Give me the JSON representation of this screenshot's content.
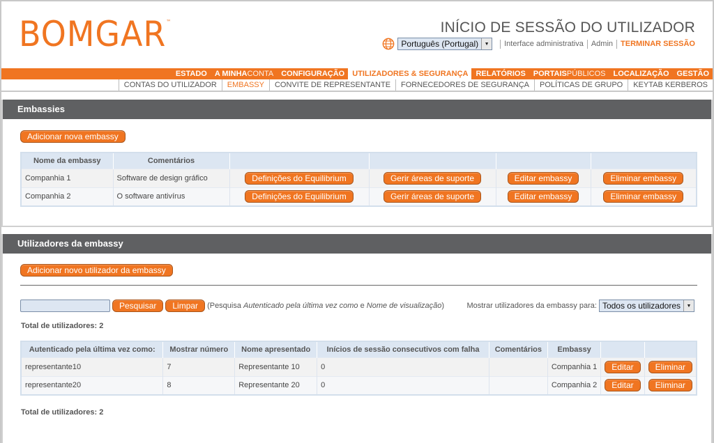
{
  "header": {
    "logo": "BOMGAR",
    "logo_tm": "™",
    "title": "INÍCIO DE SESSÃO DO UTILIZADOR",
    "language": "Português (Portugal)",
    "links": [
      "Interface administrativa",
      "Admin"
    ],
    "logout": "TERMINAR SESSÃO"
  },
  "nav": {
    "items": [
      {
        "bold": "ESTADO",
        "light": ""
      },
      {
        "bold": "A MINHA",
        "light": "CONTA"
      },
      {
        "bold": "CONFIGURAÇÃO",
        "light": ""
      },
      {
        "bold": "UTILIZADORES & SEGURANÇA",
        "light": ""
      },
      {
        "bold": "RELATÓRIOS",
        "light": ""
      },
      {
        "bold": "PORTAIS",
        "light": "PÚBLICOS"
      },
      {
        "bold": "LOCALIZAÇÃO",
        "light": ""
      },
      {
        "bold": "GESTÃO",
        "light": ""
      }
    ],
    "active_index": 3,
    "subitems": [
      "CONTAS DO UTILIZADOR",
      "EMBASSY",
      "CONVITE DE REPRESENTANTE",
      "FORNECEDORES DE SEGURANÇA",
      "POLÍTICAS DE GRUPO",
      "KEYTAB KERBEROS"
    ],
    "sub_active_index": 1
  },
  "embassies": {
    "title": "Embassies",
    "add_button": "Adicionar nova embassy",
    "columns": [
      "Nome da embassy",
      "Comentários"
    ],
    "rows": [
      {
        "name": "Companhia 1",
        "comment": "Software de design gráfico"
      },
      {
        "name": "Companhia 2",
        "comment": "O software antivírus"
      }
    ],
    "row_actions": [
      "Definições do Equilibrium",
      "Gerir áreas de suporte",
      "Editar embassy",
      "Eliminar embassy"
    ]
  },
  "users": {
    "title": "Utilizadores da embassy",
    "add_button": "Adicionar novo utilizador da embassy",
    "search_value": "",
    "search_button": "Pesquisar",
    "clear_button": "Limpar",
    "hint_prefix": "(Pesquisa ",
    "hint_field1": "Autenticado pela última vez como",
    "hint_mid": " e ",
    "hint_field2": "Nome de visualização",
    "hint_suffix": ")",
    "filter_label": "Mostrar utilizadores da embassy para:",
    "filter_value": "Todos os utilizadores",
    "total_label": "Total de utilizadores: 2",
    "columns": [
      "Autenticado pela última vez como:",
      "Mostrar número",
      "Nome apresentado",
      "Inícios de sessão consecutivos com falha",
      "Comentários",
      "Embassy"
    ],
    "rows": [
      {
        "login": "representante10",
        "number": "7",
        "display": "Representante 10",
        "failed": "0",
        "comment": "",
        "embassy": "Companhia 1"
      },
      {
        "login": "representante20",
        "number": "8",
        "display": "Representante 20",
        "failed": "0",
        "comment": "",
        "embassy": "Companhia 2"
      }
    ],
    "edit_button": "Editar",
    "delete_button": "Eliminar"
  },
  "colors": {
    "accent": "#f07521",
    "panel_header": "#5f6062",
    "table_header": "#dce6f2"
  }
}
